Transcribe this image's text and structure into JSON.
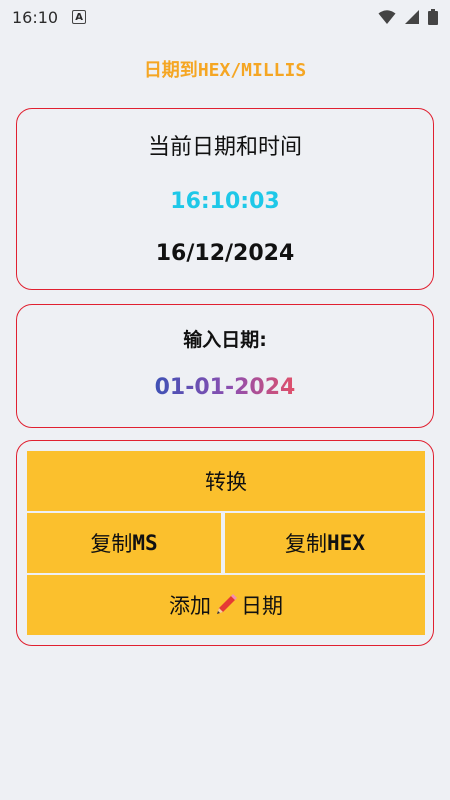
{
  "status_bar": {
    "time": "16:10",
    "icons": [
      "a-icon",
      "wifi-icon",
      "signal-icon",
      "battery-icon"
    ]
  },
  "app": {
    "title_prefix": "日期到",
    "title_suffix": "HEX/MILLIS"
  },
  "current_card": {
    "title": "当前日期和时间",
    "time": "16:10:03",
    "date": "16/12/2024"
  },
  "input_card": {
    "label": "输入日期:",
    "date_value": "01-01-2024"
  },
  "actions": {
    "convert_label": "转换",
    "copy_ms_prefix": "复制",
    "copy_ms_suffix": "MS",
    "copy_hex_prefix": "复制",
    "copy_hex_suffix": "HEX",
    "add_date_prefix": "添加",
    "add_date_suffix": "日期"
  },
  "colors": {
    "accent_orange": "#f5a623",
    "time_cyan": "#1ec8e8",
    "card_border": "#e02030",
    "button_yellow": "#fbc02d"
  }
}
